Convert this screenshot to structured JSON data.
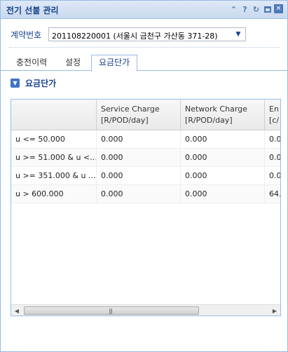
{
  "window": {
    "title": "전기 선불 관리",
    "tools": [
      "collapse-icon",
      "help-icon",
      "refresh-icon",
      "maximize-icon",
      "close-icon"
    ]
  },
  "contract": {
    "label": "계약번호",
    "value": "201108220001 (서울시 금천구 가산동 371-28)"
  },
  "tabs": [
    {
      "label": "충전이력",
      "active": false
    },
    {
      "label": "설정",
      "active": false
    },
    {
      "label": "요금단가",
      "active": true
    }
  ],
  "section": {
    "title": "요금단가"
  },
  "grid": {
    "columns": [
      {
        "line1": "",
        "line2": ""
      },
      {
        "line1": "Service Charge",
        "line2": "[R/POD/day]"
      },
      {
        "line1": "Network Charge",
        "line2": "[R/POD/day]"
      },
      {
        "line1": "En",
        "line2": "[c/"
      }
    ],
    "rows": [
      [
        "u <= 50.000",
        "0.000",
        "0.000",
        "0.0"
      ],
      [
        "u >= 51.000 & u <…",
        "0.000",
        "0.000",
        "0.0"
      ],
      [
        "u >= 351.000 & u …",
        "0.000",
        "0.000",
        "0.0"
      ],
      [
        "u > 600.000",
        "0.000",
        "0.000",
        "64."
      ]
    ]
  }
}
